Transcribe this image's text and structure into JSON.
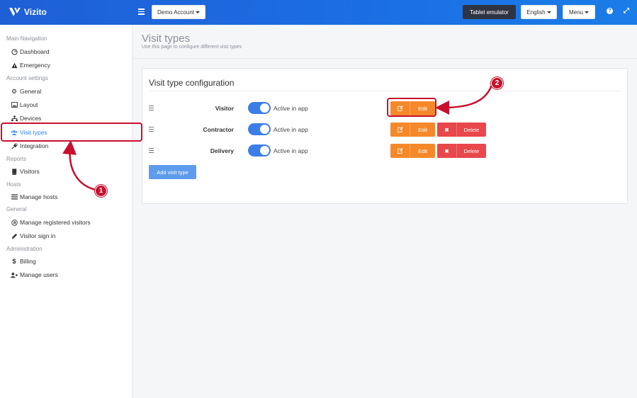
{
  "app": {
    "name": "Vizito"
  },
  "topbar": {
    "account_label": "Demo Account",
    "tablet_label": "Tablet emulator",
    "language_label": "English",
    "menu_label": "Menu",
    "help_glyph": "?",
    "expand_glyph": "⤢"
  },
  "sidebar": {
    "sections": [
      {
        "title": "Main Navigation",
        "items": [
          {
            "label": "Dashboard",
            "icon": "dashboard-icon"
          },
          {
            "label": "Emergency",
            "icon": "warning-icon"
          }
        ]
      },
      {
        "title": "Account settings",
        "items": [
          {
            "label": "General",
            "icon": "gear-icon"
          },
          {
            "label": "Layout",
            "icon": "image-icon"
          },
          {
            "label": "Devices",
            "icon": "sitemap-icon"
          },
          {
            "label": "Visit types",
            "icon": "users-icon"
          },
          {
            "label": "Integration",
            "icon": "plug-icon"
          }
        ]
      },
      {
        "title": "Reports",
        "items": [
          {
            "label": "Visitors",
            "icon": "book-icon"
          }
        ]
      },
      {
        "title": "Hosts",
        "items": [
          {
            "label": "Manage hosts",
            "icon": "list-icon"
          }
        ]
      },
      {
        "title": "General",
        "items": [
          {
            "label": "Manage registered visitors",
            "icon": "registered-icon"
          },
          {
            "label": "Visitor sign in",
            "icon": "pencil-icon"
          }
        ]
      },
      {
        "title": "Administration",
        "items": [
          {
            "label": "Billing",
            "icon": "dollar-icon"
          },
          {
            "label": "Manage users",
            "icon": "user-plus-icon"
          }
        ]
      }
    ],
    "active_item": "Visit types"
  },
  "page": {
    "title": "Visit types",
    "subtitle": "Use this page to configure different visit types"
  },
  "card": {
    "title": "Visit type configuration",
    "rows": [
      {
        "name": "Visitor",
        "toggle_label": "Active in app",
        "active": true,
        "edit_label": "Edit",
        "delete_label": ""
      },
      {
        "name": "Contractor",
        "toggle_label": "Active in app",
        "active": true,
        "edit_label": "Edit",
        "delete_label": "Delete"
      },
      {
        "name": "Delivery",
        "toggle_label": "Active in app",
        "active": true,
        "edit_label": "Edit",
        "delete_label": "Delete"
      }
    ],
    "add_label": "Add visit type"
  },
  "annotations": {
    "badge_1": "1",
    "badge_2": "2",
    "color": "#c8102e"
  }
}
